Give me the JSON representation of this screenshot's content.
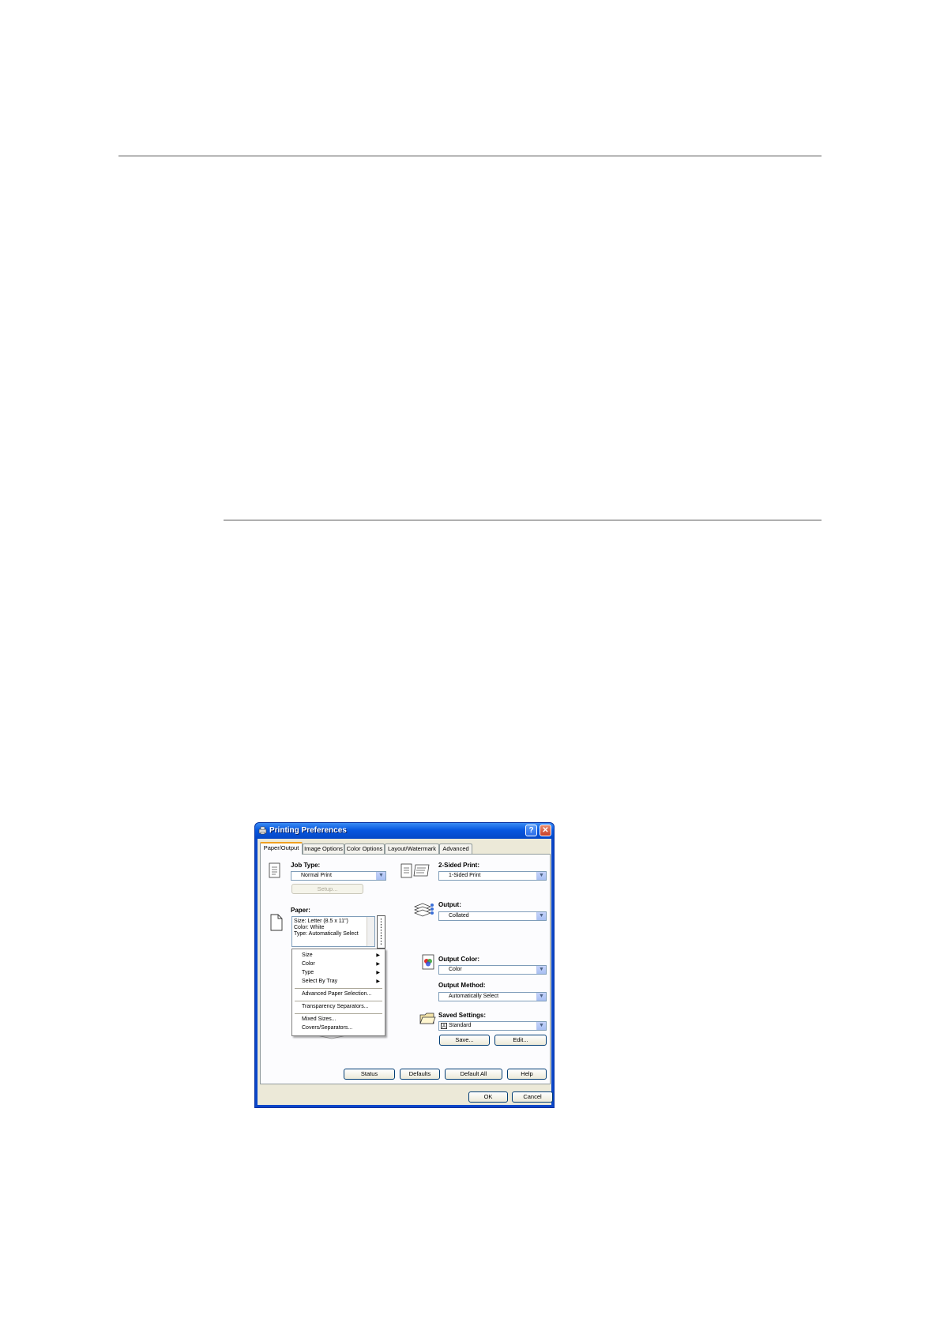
{
  "window": {
    "title": "Printing Preferences",
    "help_label": "?",
    "close_label": "✕"
  },
  "tabs": [
    {
      "label": "Paper/Output",
      "active": true
    },
    {
      "label": "Image Options",
      "active": false
    },
    {
      "label": "Color Options",
      "active": false
    },
    {
      "label": "Layout/Watermark",
      "active": false
    },
    {
      "label": "Advanced",
      "active": false
    }
  ],
  "job_type": {
    "label": "Job Type:",
    "value": "Normal Print",
    "setup_label": "Setup..."
  },
  "two_sided": {
    "label": "2-Sided Print:",
    "value": "1-Sided Print"
  },
  "paper": {
    "label": "Paper:",
    "lines": [
      "Size: Letter (8.5 x 11\")",
      "Color: White",
      "Type: Automatically Select"
    ]
  },
  "output": {
    "label": "Output:",
    "value": "Collated"
  },
  "output_color": {
    "label": "Output Color:",
    "value": "Color"
  },
  "output_method": {
    "label": "Output Method:",
    "value": "Automatically Select"
  },
  "saved_settings": {
    "label": "Saved Settings:",
    "value": "Standard",
    "badge": "A",
    "save_label": "Save...",
    "edit_label": "Edit..."
  },
  "context_menu": {
    "items": [
      "Size",
      "Color",
      "Type",
      "Select By Tray",
      "Advanced Paper Selection...",
      "Transparency Separators...",
      "Mixed Sizes...",
      "Covers/Separators..."
    ]
  },
  "bottom_buttons": {
    "status": "Status",
    "defaults": "Defaults",
    "default_all": "Default All",
    "help": "Help"
  },
  "dialog_buttons": {
    "ok": "OK",
    "cancel": "Cancel"
  },
  "colors": {
    "title_blue": "#0757e0",
    "face": "#ece9d8",
    "accent_tab": "#f0a020"
  }
}
